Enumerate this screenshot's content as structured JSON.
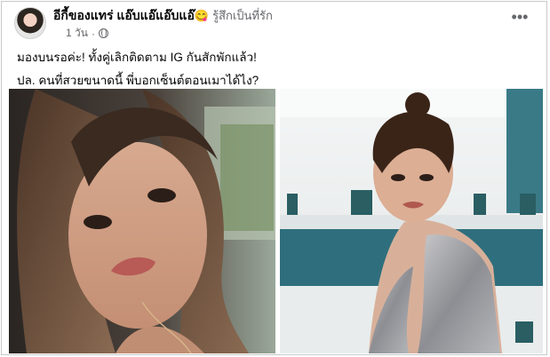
{
  "post": {
    "page_name": "อีกี้ของแทร่ แอ๊บแอ๊แอ๊บแอ๊",
    "emoji": "😋",
    "feeling": "รู้สึกเป็นที่รัก",
    "time": "1 วัน",
    "privacy_icon": "globe-icon",
    "more_icon": "more-horizontal-icon",
    "caption_line1": "มองบนรอค่ะ! ทั้งคู่เลิกติดตาม IG กันสักพักแล้ว!",
    "caption_line2": "ปล. คนที่สวยขนาดนี้ พี่บอกเซ็นต์ตอนเมาได้ไง?"
  },
  "photos": [
    {
      "name": "selfie-in-car"
    },
    {
      "name": "woman-in-silver-dress"
    }
  ],
  "colors": {
    "secondary_text": "#65676b",
    "primary_text": "#050505",
    "frame_border": "#c8c8c8"
  }
}
